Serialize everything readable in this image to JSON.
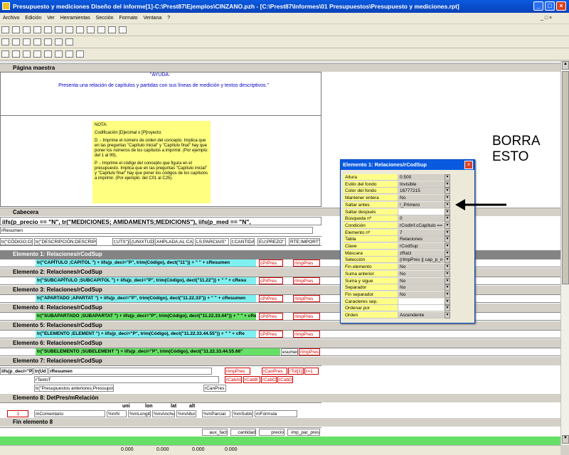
{
  "window": {
    "title": "Presupuesto y mediciones Diseño del informe[1]-C:\\Prest87\\Ejemplos\\CINZANO.pzh - [C:\\Prest87\\Informes\\01 Presupuestos\\Presupuesto y mediciones.rpt]"
  },
  "menu": [
    "Archivo",
    "Edición",
    "Ver",
    "Herramientas",
    "Sección",
    "Formato",
    "Ventana",
    "?"
  ],
  "sections": {
    "master": "Página maestra",
    "header": "Cabecera",
    "fin": "Fin elemento 8"
  },
  "master": {
    "ayuda": "\"AYUDA:",
    "ayuda_text": "Presenta una relación de capítulos y partidas con sus líneas de medición y textos descriptivos.\"",
    "nota": "NOTA:",
    "nota1": "Codificación [D]ecimal o [P]royecto:",
    "nota2": "D .- Imprime el número de orden del concepto. Implica que en las preguntas \"Capítulo inicial\" y \"Capítulo final\" hay que poner los números de los capítulos a imprimir. (Por ejemplo: del 1 al 99).",
    "nota3": "P .- Imprime el código del concepto que figura en el presupuesto. Implica que en las preguntas \"Capítulo inicial\" y \"Capítulo final\" hay que poner los códigos de los capítulos a imprimir. (Por ejemplo: del C01 al C25)."
  },
  "cabecera": {
    "formula": "iifs(p_precio == \"N\", tr(\"MEDICIONES; AMIDAMENTS;MEDICIONS\"), iifs(p_med == \"N\",",
    "resumen": "rResumen",
    "cols": [
      "tr(\"CÓDIGO;CO",
      "tr(\"DESCRIPCIÓN;DESCRIPCI",
      "t;UTS\")",
      "(UNIXTUDE\"",
      "AHPLADA;AL CADA",
      "LS;PARCIAIS\"",
      "t;CANTIDADE",
      "EU;PREZO\"",
      "RTE;IMPORT\")"
    ]
  },
  "elements": [
    {
      "title": "Elemento 1: Relaciones/rCodSup",
      "formula": "tr(\"CAPÍTULO ;CAPITOL \") + iifs(p_deci=\"P\", trim(Código), dect(\"11\")) + \" \" + cResumen",
      "f1": "cPrPres",
      "f2": "rImpPres"
    },
    {
      "title": "Elemento 2: Relaciones/rCodSup",
      "formula": "tr(\"SUBCAPÍTULO ;SUBCAPITOL \") + iifs(p_deci=\"P\", trim(Código), dect(\"11.22\")) + \" \" + cResu",
      "f1": "cPrPres",
      "f2": "rImpPres"
    },
    {
      "title": "Elemento 3: Relaciones/rCodSup",
      "formula": "tr(\"APARTADO ;APARTAT \") + iifs(p_deci=\"P\", trim(Código), dect(\"11.22.33\")) + \" \" + cResumen",
      "f1": "cPrPres",
      "f2": "rImpPres"
    },
    {
      "title": "Elemento 4: Relaciones/rCodSup",
      "formula": "tr(\"SUBAPARTADO ;SUBAPARTAT \") + iifs(p_deci=\"P\", trim(Código), dect(\"11.22.33.44\")) + \" \" + cRes",
      "f1": "cPrPres",
      "f2": "rImpPres"
    },
    {
      "title": "Elemento 5: Relaciones/rCodSup",
      "formula": "tr(\"ELEMENTO ;ELEMENT \") + iifs(p_deci=\"P\", trim(Código), dect(\"11.22.33.44.55\")) + \" \" + cRe",
      "f1": "cPrPres",
      "f2": "rImpPres"
    },
    {
      "title": "Elemento 6: Relaciones/rCodSup",
      "formula": "tr(\"SUBELEMENTO ;SUBELEMENT \") + iifs(p_deci=\"P\", trim(Código), dect(\"11.22.33.44.55.66\"",
      "f1": "esumen",
      "f2": "rImpPres"
    },
    {
      "title": "Elemento 7: Relaciones/rCodSup"
    },
    {
      "title": "Elemento 8: DetPres/mRelación"
    }
  ],
  "el7": {
    "a": "iifs(p_deci=\"P\"",
    "b": "tr(Ud",
    "c": "rResumen",
    "d": "rImpPres",
    "e": "rCanPres",
    "f": "rTot[1]",
    "g": "r=1",
    "h": "rCabAU",
    "i": "rCabB",
    "j": "rCabC",
    "k": "rCabD",
    "l": "rTextoT",
    "m": "tr(\"Presupuestos anteriores;Pressupostos",
    "n": "rCanPres"
  },
  "el8": {
    "h1": "uni",
    "h2": "lon",
    "h3": "lat",
    "h4": "alt",
    "n": "1",
    "c1": "mComentario",
    "c2": "%mN",
    "c3": "%mLongitud",
    "c4": "%mAnchura",
    "c5": "%mAltura",
    "c6": "%mParcial",
    "c7": "%mSubtotal",
    "c8": "mFórmula"
  },
  "fin": {
    "c1": "aux_fact",
    "c2": "cantidad",
    "c3": "precio",
    "c4": "imp_par_pres"
  },
  "status": [
    "0.000",
    "0.000",
    "0.000",
    "0.000"
  ],
  "panel": {
    "title": "Elemento 1: Relaciones/rCodSup",
    "rows": [
      [
        "Altura",
        "0.500"
      ],
      [
        "Estilo del fondo",
        "Invisible"
      ],
      [
        "Color del fondo",
        "16777215"
      ],
      [
        "Mantener entera",
        "No"
      ],
      [
        "Saltar antes",
        "!_Primero"
      ],
      [
        "Saltar después",
        ""
      ],
      [
        "Búsqueda nº",
        "0"
      ],
      [
        "Condición",
        "rCodInf.cCapítulo =="
      ],
      [
        "Elemento nº",
        "7"
      ],
      [
        "Tabla",
        "Relaciones"
      ],
      [
        "Clave",
        "rCodSup"
      ],
      [
        "Máscara",
        "zRaíz"
      ],
      [
        "Selección",
        "(rImpPres || cap_p_n"
      ],
      [
        "Fin elemento",
        "No"
      ],
      [
        "Suma anterior",
        "No"
      ],
      [
        "Suma y sigue",
        "No"
      ],
      [
        "Separador",
        "No"
      ],
      [
        "Fin separador",
        "No"
      ],
      [
        "Caracteres sep.",
        ""
      ],
      [
        "Ordenar por",
        ""
      ],
      [
        "Orden",
        "Ascendente"
      ]
    ]
  },
  "annotation": {
    "line1": "BORRA",
    "line2": "ESTO"
  }
}
